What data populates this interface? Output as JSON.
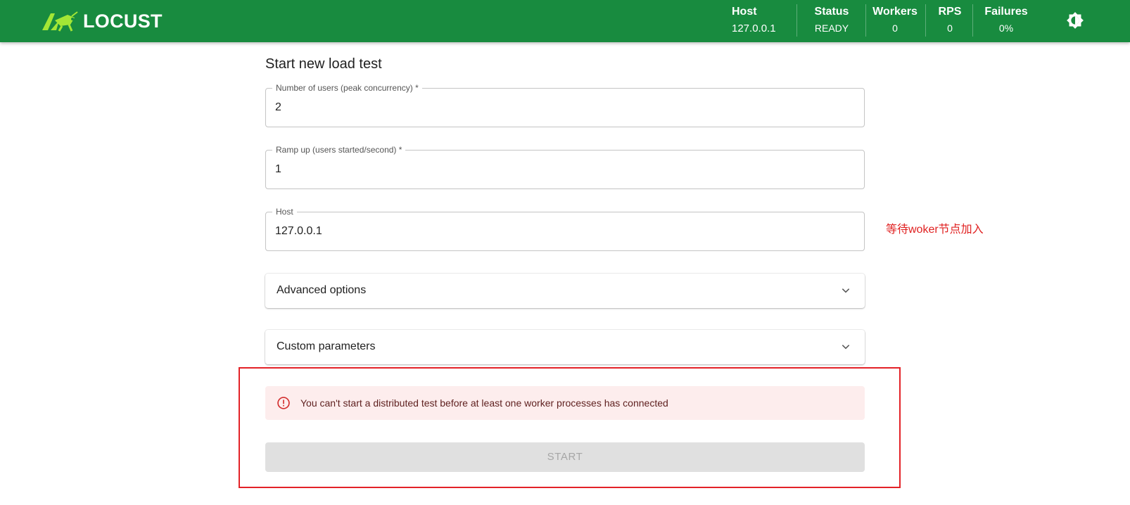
{
  "header": {
    "brand": "LOCUST",
    "colors": {
      "bar": "#188b3f",
      "text": "#ffffff"
    },
    "stats": [
      {
        "label": "Host",
        "value": "127.0.0.1"
      },
      {
        "label": "Status",
        "value": "READY"
      },
      {
        "label": "Workers",
        "value": "0"
      },
      {
        "label": "RPS",
        "value": "0"
      },
      {
        "label": "Failures",
        "value": "0%"
      }
    ],
    "theme_icon": "brightness-icon"
  },
  "form": {
    "title": "Start new load test",
    "users": {
      "label": "Number of users (peak concurrency) *",
      "value": "2"
    },
    "ramp_up": {
      "label": "Ramp up (users started/second) *",
      "value": "1"
    },
    "host": {
      "label": "Host",
      "value": "127.0.0.1"
    },
    "advanced_options": "Advanced options",
    "custom_parameters": "Custom parameters",
    "alert": {
      "text": "You can't start a distributed test before at least one worker processes has connected",
      "icon": "error-outline-icon",
      "color": "#d32f2f"
    },
    "start_button": "START"
  },
  "annotation": {
    "text": "等待woker节点加入",
    "color": "#e02020"
  }
}
